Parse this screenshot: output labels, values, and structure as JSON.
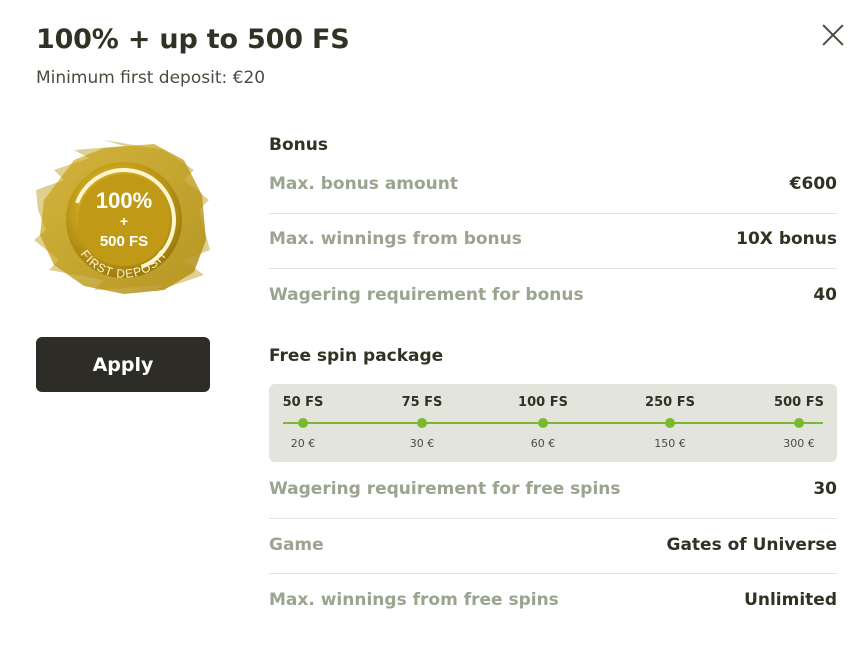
{
  "header": {
    "title": "100% + up to 500 FS",
    "subtitle": "Minimum first deposit:  €20",
    "close_icon": "close-icon"
  },
  "badge": {
    "percent": "100%",
    "plus": "+",
    "fs": "500 FS",
    "arc_text": "FIRST DEPOSIT",
    "colors": {
      "gold": "#c9a31c",
      "gold_dark": "#9c7a0c",
      "gold_light": "#e4c64a"
    }
  },
  "apply_button": {
    "label": "Apply"
  },
  "bonus": {
    "section_title": "Bonus",
    "rows": [
      {
        "label": "Max. bonus amount",
        "value": "€600"
      },
      {
        "label": "Max. winnings from bonus",
        "value": "10X bonus"
      },
      {
        "label": "Wagering requirement for bonus",
        "value": "40"
      }
    ]
  },
  "free_spins": {
    "section_title": "Free spin package",
    "steps": [
      {
        "fs": "50 FS",
        "deposit": "20 €"
      },
      {
        "fs": "75 FS",
        "deposit": "30 €"
      },
      {
        "fs": "100 FS",
        "deposit": "60 €"
      },
      {
        "fs": "250 FS",
        "deposit": "150 €"
      },
      {
        "fs": "500 FS",
        "deposit": "300 €"
      }
    ],
    "rows": [
      {
        "label": "Wagering requirement for free spins",
        "value": "30"
      },
      {
        "label": "Game",
        "value": "Gates of Universe"
      },
      {
        "label": "Max. winnings from free spins",
        "value": "Unlimited"
      }
    ]
  },
  "colors": {
    "accent_green": "#7cb82f",
    "muted_label": "#9aa48e",
    "dark_text": "#2f3323",
    "button_bg": "#2d2c27",
    "spin_panel_bg": "#e3e5dc"
  }
}
